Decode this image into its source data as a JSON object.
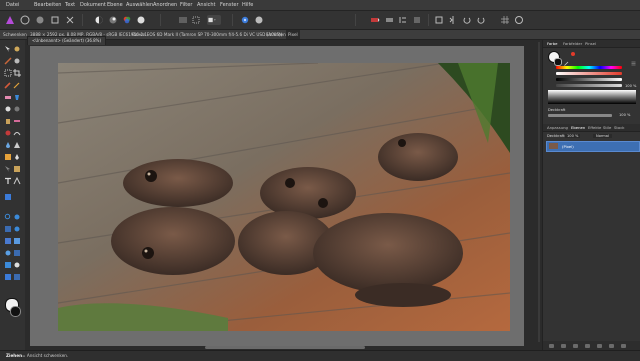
{
  "menu": [
    "Datei",
    "Bearbeiten",
    "Text",
    "Dokument",
    "Ebene",
    "Auswählen",
    "Anordnen",
    "Filter",
    "Ansicht",
    "Fenster",
    "Hilfe"
  ],
  "context_bar": {
    "panel_label": "Schwenken",
    "image_info": "3888 × 2592 px, 8,08 MP, RGBA/8 - sRGB IEC61966-2.1",
    "camera_info": "Canon EOS 6D Mark II (Tamron SP 70-300mm f/4-5.6 Di VC USD (A005))",
    "units_label": "Einheiten:",
    "units_value": "Pixel"
  },
  "document": {
    "tab_label": "<Unbenannt> (Geändert) (36.8%)"
  },
  "color_panel": {
    "tabs": [
      "Farbe",
      "Farbfelder",
      "Pinsel"
    ],
    "opacity_label": "Deckkraft",
    "opacity_value": "100 %",
    "alpha_value": "100 %",
    "accent": "#e23b2b"
  },
  "layers_panel": {
    "tabs": [
      "Anpassung",
      "Ebenen",
      "Effekte",
      "Stile",
      "Stock"
    ],
    "opacity_label": "Deckkraft:",
    "opacity_value": "100 %",
    "blend_mode": "Normal",
    "layer_name": "(Pixel)"
  },
  "status": {
    "tool_name": "Ziehen",
    "hint": "= Ansicht schwenken."
  }
}
